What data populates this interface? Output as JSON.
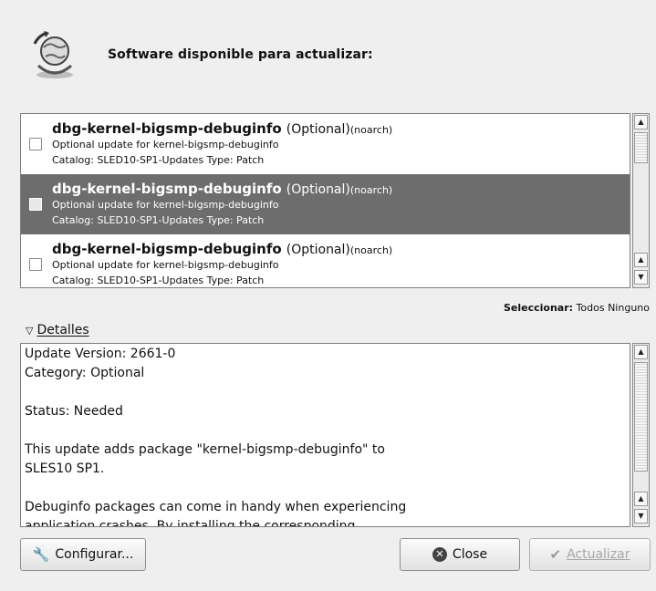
{
  "header": {
    "title": "Software disponible para actualizar:",
    "icon": "globe-update-icon"
  },
  "updates": [
    {
      "name": "dbg-kernel-bigsmp-debuginfo",
      "status": "(Optional)",
      "arch": "(noarch)",
      "description": "Optional update for kernel-bigsmp-debuginfo",
      "catalog": "Catalog: SLED10-SP1-Updates Type: Patch",
      "selected": false
    },
    {
      "name": "dbg-kernel-bigsmp-debuginfo",
      "status": "(Optional)",
      "arch": "(noarch)",
      "description": "Optional update for kernel-bigsmp-debuginfo",
      "catalog": "Catalog: SLED10-SP1-Updates Type: Patch",
      "selected": true
    },
    {
      "name": "dbg-kernel-bigsmp-debuginfo",
      "status": "(Optional)",
      "arch": "(noarch)",
      "description": "Optional update for kernel-bigsmp-debuginfo",
      "catalog": "Catalog: SLED10-SP1-Updates Type: Patch",
      "selected": false
    }
  ],
  "select": {
    "label": "Seleccionar:",
    "all": "Todos",
    "none": "Ninguno"
  },
  "details": {
    "label": "Detalles",
    "expanded": true,
    "lines": [
      "Update Version: 2661-0",
      "Category: Optional",
      "",
      "Status: Needed",
      "",
      "This update adds package \"kernel-bigsmp-debuginfo\" to",
      "SLES10 SP1.",
      "",
      "Debuginfo packages can come in handy when experiencing",
      "application crashes. By installing the corresponding"
    ]
  },
  "buttons": {
    "configure": "Configurar...",
    "close": "Close",
    "update": "Actualizar",
    "update_enabled": false
  },
  "colors": {
    "selected_row": "#6d6d6d",
    "background": "#efefef"
  }
}
